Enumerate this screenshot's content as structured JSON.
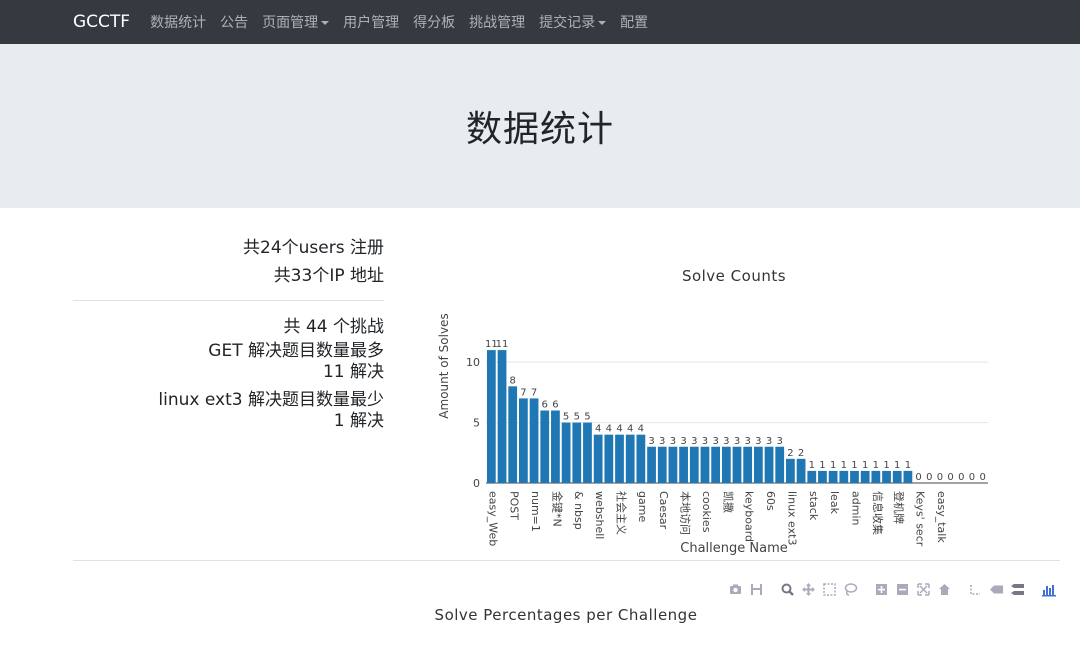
{
  "nav": {
    "brand": "GCCTF",
    "items": [
      {
        "label": "数据统计",
        "dropdown": false
      },
      {
        "label": "公告",
        "dropdown": false
      },
      {
        "label": "页面管理",
        "dropdown": true
      },
      {
        "label": "用户管理",
        "dropdown": false
      },
      {
        "label": "得分板",
        "dropdown": false
      },
      {
        "label": "挑战管理",
        "dropdown": false
      },
      {
        "label": "提交记录",
        "dropdown": true
      },
      {
        "label": "配置",
        "dropdown": false
      }
    ]
  },
  "page_title": "数据统计",
  "stats": {
    "users_line": "共24个users 注册",
    "ip_line": "共33个IP 地址",
    "challenges_line": "共 44 个挑战",
    "most_title": "GET 解决题目数量最多",
    "most_count": "11 解决",
    "least_title": "linux ext3 解决题目数量最少",
    "least_count": "1 解决"
  },
  "chart_data": {
    "type": "bar",
    "title": "Solve Counts",
    "xlabel": "Challenge Name",
    "ylabel": "Amount of Solves",
    "ylim": [
      0,
      12
    ],
    "y_ticks": [
      0,
      5,
      10
    ],
    "bar_color": "#1f77b4",
    "tick_labels": [
      "easy_Web",
      "POST",
      "num=1",
      "金键*N",
      "& nbsp",
      "webshell",
      "社会主义",
      "game",
      "Caesar",
      "本地访问",
      "cookies",
      "凯撒",
      "keyboard",
      "60s",
      "linux ext3",
      "stack",
      "leak",
      "admin",
      "信息收集",
      "登机牌",
      "Keys' secr",
      "easy_talk"
    ],
    "values": [
      11,
      11,
      8,
      7,
      7,
      6,
      6,
      5,
      5,
      5,
      4,
      4,
      4,
      4,
      4,
      3,
      3,
      3,
      3,
      3,
      3,
      3,
      3,
      3,
      3,
      3,
      3,
      3,
      2,
      2,
      1,
      1,
      1,
      1,
      1,
      1,
      1,
      1,
      1,
      1,
      0,
      0,
      0,
      0,
      0,
      0,
      0
    ]
  },
  "modebar": {
    "icons": [
      "camera-icon",
      "save-icon",
      "zoom-icon",
      "pan-icon",
      "box-select-icon",
      "lasso-icon",
      "zoom-in-icon",
      "zoom-out-icon",
      "autoscale-icon",
      "reset-axes-icon",
      "spike-lines-icon",
      "hover-closest-icon",
      "hover-compare-icon",
      "plotly-logo-icon"
    ]
  },
  "bottom_chart_title": "Solve Percentages per Challenge"
}
